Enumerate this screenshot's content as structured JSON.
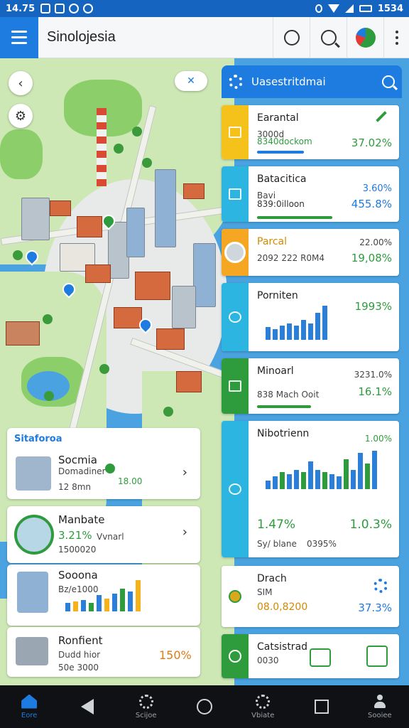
{
  "status_bar": {
    "time": "14.75",
    "right_text": "1534"
  },
  "app_bar": {
    "title": "Sinolojesia"
  },
  "panel": {
    "title": "Uasestritdmai",
    "cards": [
      {
        "name": "Earantal",
        "sub": "3000d",
        "sub2": "8340dockom",
        "value": "37.02%",
        "accent": "#f5c11b",
        "value_color": "#2e9c3d"
      },
      {
        "name": "Batacitica",
        "sub": "Bavi",
        "sub2": "839:0illoon",
        "value_top": "3.60%",
        "value": "455.8%",
        "accent": "#2bb5e0",
        "value_color": "#1e7be0"
      },
      {
        "name": "Parcal",
        "sub": "2092 222 R0M4",
        "value_top": "22.00%",
        "value": "19,08%",
        "accent": "#f5a623",
        "value_color": "#2e9c3d"
      },
      {
        "name": "Porniten",
        "value": "1993%",
        "accent": "#2bb5e0",
        "value_color": "#2e9c3d",
        "bars": [
          0.35,
          0.3,
          0.4,
          0.45,
          0.4,
          0.55,
          0.45,
          0.75,
          0.95
        ]
      },
      {
        "name": "Minoarl",
        "sub": "838 Mach Ooit",
        "value_top": "3231.0%",
        "value": "16.1%",
        "accent": "#2e9c3d",
        "value_color": "#2e9c3d"
      },
      {
        "name": "Nibotrienn",
        "sub": "Sy/ blane",
        "value": "1.47%",
        "value_mid": "0395%",
        "value_right": "1.0.3%",
        "value_top": "1.00%",
        "accent": "#2bb5e0",
        "value_color": "#2e9c3d",
        "bars": [
          0.2,
          0.3,
          0.4,
          0.35,
          0.45,
          0.4,
          0.65,
          0.45,
          0.4,
          0.35,
          0.3,
          0.7,
          0.45,
          0.85,
          0.6,
          0.9
        ]
      },
      {
        "name": "Drach",
        "sub": "SIM",
        "sub2": "08.0,8200",
        "value": "37.3%",
        "accent": "#ffffff",
        "value_color": "#1e7be0"
      },
      {
        "name": "Catsistrad",
        "sub": "0030",
        "accent": "#2e9c3d"
      }
    ]
  },
  "left": {
    "card1": {
      "heading": "Sitaforoa",
      "name": "Socmia",
      "sub": "Domadiner",
      "sub2": "12 8mn",
      "value": "18.00"
    },
    "card2": {
      "name": "Manbate",
      "value": "3.21%",
      "value_suffix": "Vvnarl",
      "sub": "1500020"
    },
    "card3": {
      "name": "Sooona",
      "sub": "Bz/e1000",
      "bars": [
        0.25,
        0.3,
        0.35,
        0.25,
        0.5,
        0.4,
        0.55,
        0.7,
        0.6,
        0.95
      ]
    },
    "card4": {
      "name": "Ronfient",
      "sub": "Dudd hior",
      "sub2": "50e 3000",
      "value": "150%"
    }
  },
  "nav": [
    {
      "label": "Eore",
      "icon": "home-icon",
      "active": true
    },
    {
      "label": "",
      "icon": "back-icon"
    },
    {
      "label": "Scijoe",
      "icon": "explore-icon"
    },
    {
      "label": "",
      "icon": "home-circle-icon"
    },
    {
      "label": "Vbiate",
      "icon": "location-icon"
    },
    {
      "label": "",
      "icon": "recents-icon"
    },
    {
      "label": "Sooiee",
      "icon": "profile-icon"
    }
  ],
  "colors": {
    "primary": "#1e7be0",
    "green": "#2e9c3d",
    "navbar": "#101114"
  }
}
